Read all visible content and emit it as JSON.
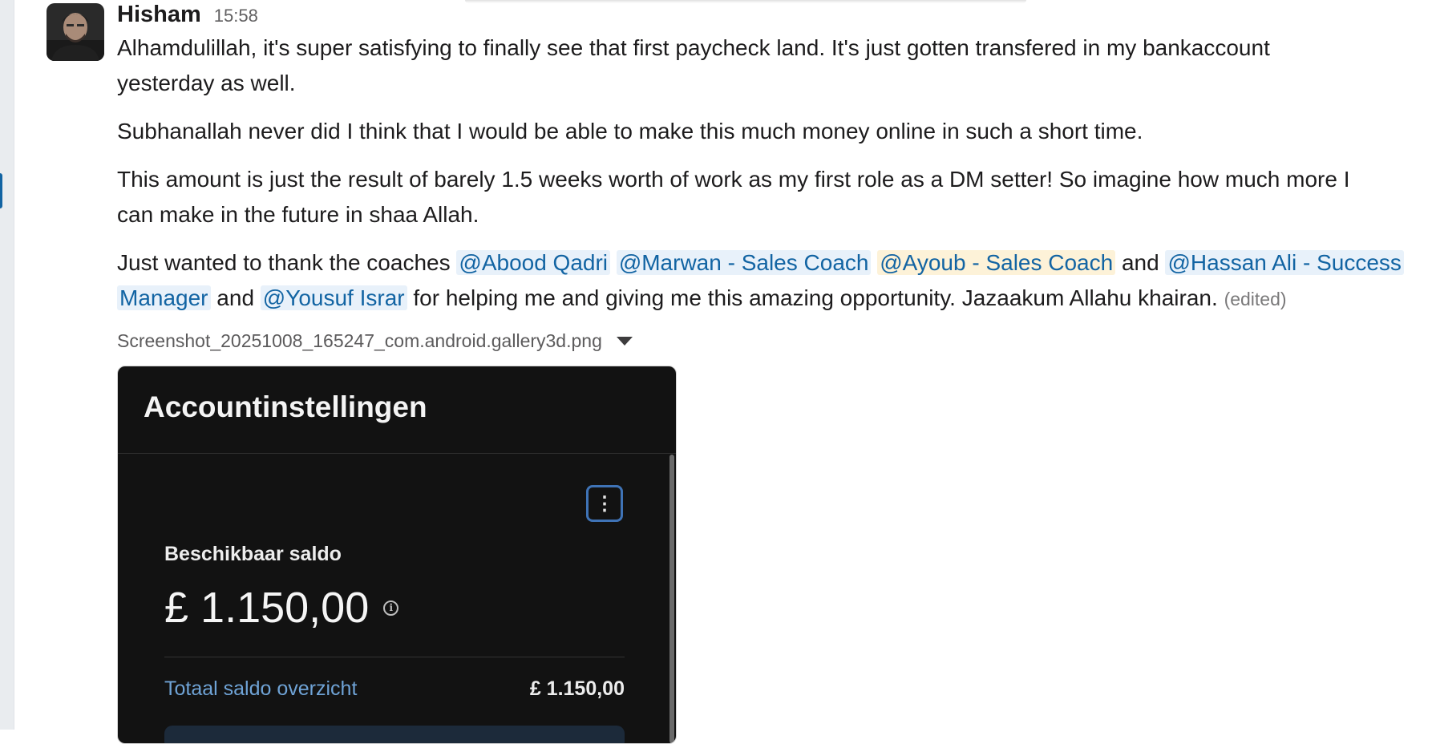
{
  "message": {
    "sender": "Hisham",
    "time": "15:58",
    "paragraphs": {
      "p1": "Alhamdulillah, it's super satisfying to finally see that first paycheck land. It's just gotten transfered in my bankaccount",
      "p1b": "yesterday as well.",
      "p2": "Subhanallah never did I think that I would be able to make this much money online in such a short time.",
      "p3": "This amount is just the result of barely 1.5 weeks worth of work as my first role as a DM setter! So imagine how much more I",
      "p3b": "can make in the future in shaa Allah.",
      "p4_lead": "Just wanted to thank the coaches",
      "and_1": "and",
      "and_2": "and",
      "p4_tail": "for helping me and giving me this amazing opportunity. Jazaakum Allahu khairan."
    },
    "mentions": {
      "m1": "@Abood Qadri",
      "m2": "@Marwan - Sales Coach",
      "m3": "@Ayoub - Sales Coach",
      "m4a": "@Hassan Ali - Success",
      "m4b": "Manager",
      "m5": "@Yousuf Israr"
    },
    "edited_label": "(edited)"
  },
  "attachment": {
    "file_name": "Screenshot_20251008_165247_com.android.gallery3d.png",
    "image": {
      "title": "Accountinstellingen",
      "menu_glyph": "⋮",
      "balance_label": "Beschikbaar saldo",
      "balance_amount": "£ 1.150,00",
      "info_glyph": "i",
      "total_label": "Totaal saldo overzicht",
      "total_value": "£ 1.150,00"
    }
  },
  "colors": {
    "mention_text": "#1264a3",
    "mention_bg": "#e8f1fa",
    "mention_highlight_bg": "#fdf2d8",
    "attachment_bg": "#121212",
    "total_label": "#6fa3d6"
  }
}
